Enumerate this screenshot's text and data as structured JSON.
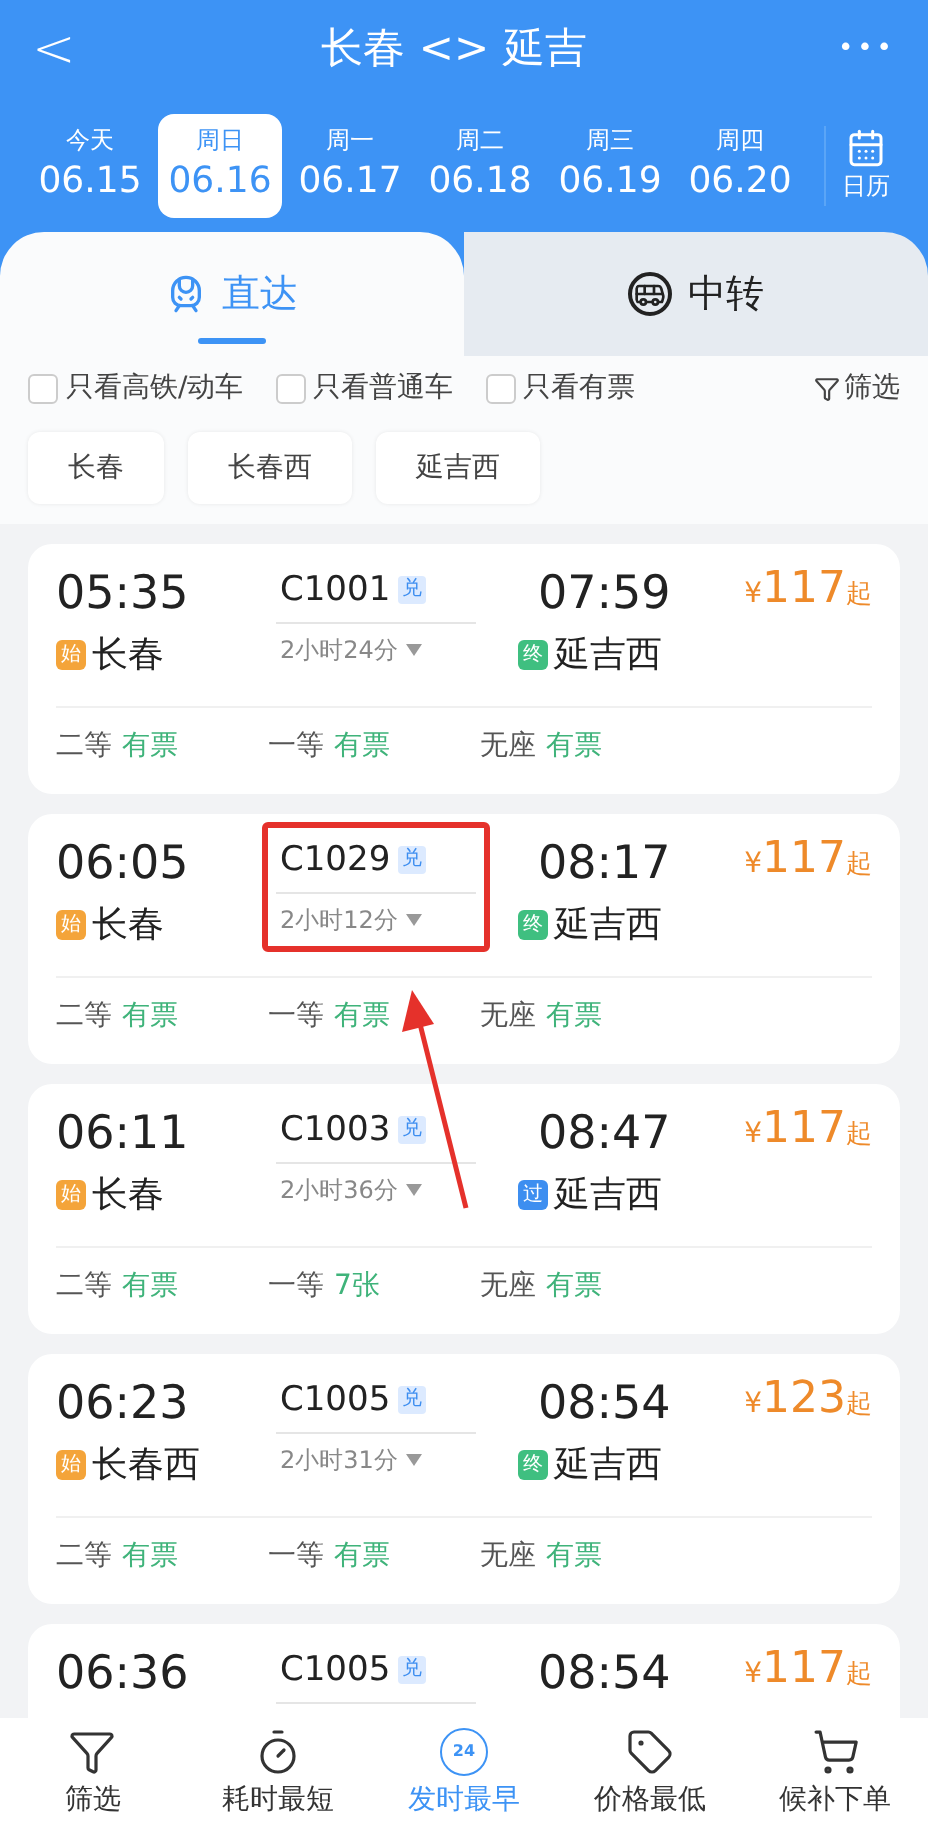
{
  "header": {
    "back": "<",
    "title": "长春 <> 延吉",
    "more": "•••"
  },
  "dates": [
    {
      "weekday": "今天",
      "date": "06.15",
      "selected": false
    },
    {
      "weekday": "周日",
      "date": "06.16",
      "selected": true
    },
    {
      "weekday": "周一",
      "date": "06.17",
      "selected": false
    },
    {
      "weekday": "周二",
      "date": "06.18",
      "selected": false
    },
    {
      "weekday": "周三",
      "date": "06.19",
      "selected": false
    },
    {
      "weekday": "周四",
      "date": "06.20",
      "selected": false
    }
  ],
  "calendar": {
    "label": "日历"
  },
  "tabs": [
    {
      "label": "直达",
      "kind": "direct",
      "selected": true
    },
    {
      "label": "中转",
      "kind": "transfer",
      "selected": false
    }
  ],
  "filters": [
    {
      "label": "只看高铁/动车",
      "checked": false
    },
    {
      "label": "只看普通车",
      "checked": false
    },
    {
      "label": "只看有票",
      "checked": false
    }
  ],
  "filter_button": "筛选",
  "stations": [
    "长春",
    "长春西",
    "延吉西"
  ],
  "trains": [
    {
      "depart": "05:35",
      "from_badge": {
        "kind": "start",
        "label": "始"
      },
      "from": "长春",
      "number": "C1001",
      "tag": "兑",
      "duration": "2小时24分",
      "arrive": "07:59",
      "to_badge": {
        "kind": "end",
        "label": "终"
      },
      "to": "延吉西",
      "price": {
        "currency": "¥",
        "amount": "117",
        "suffix": "起"
      },
      "highlighted": false,
      "seats": [
        {
          "class": "二等",
          "status": "有票"
        },
        {
          "class": "一等",
          "status": "有票"
        },
        {
          "class": "无座",
          "status": "有票"
        }
      ]
    },
    {
      "depart": "06:05",
      "from_badge": {
        "kind": "start",
        "label": "始"
      },
      "from": "长春",
      "number": "C1029",
      "tag": "兑",
      "duration": "2小时12分",
      "arrive": "08:17",
      "to_badge": {
        "kind": "end",
        "label": "终"
      },
      "to": "延吉西",
      "price": {
        "currency": "¥",
        "amount": "117",
        "suffix": "起"
      },
      "highlighted": true,
      "seats": [
        {
          "class": "二等",
          "status": "有票"
        },
        {
          "class": "一等",
          "status": "有票"
        },
        {
          "class": "无座",
          "status": "有票"
        }
      ]
    },
    {
      "depart": "06:11",
      "from_badge": {
        "kind": "start",
        "label": "始"
      },
      "from": "长春",
      "number": "C1003",
      "tag": "兑",
      "duration": "2小时36分",
      "arrive": "08:47",
      "to_badge": {
        "kind": "pass",
        "label": "过"
      },
      "to": "延吉西",
      "price": {
        "currency": "¥",
        "amount": "117",
        "suffix": "起"
      },
      "highlighted": false,
      "seats": [
        {
          "class": "二等",
          "status": "有票"
        },
        {
          "class": "一等",
          "status": "7张"
        },
        {
          "class": "无座",
          "status": "有票"
        }
      ]
    },
    {
      "depart": "06:23",
      "from_badge": {
        "kind": "start",
        "label": "始"
      },
      "from": "长春西",
      "number": "C1005",
      "tag": "兑",
      "duration": "2小时31分",
      "arrive": "08:54",
      "to_badge": {
        "kind": "end",
        "label": "终"
      },
      "to": "延吉西",
      "price": {
        "currency": "¥",
        "amount": "123",
        "suffix": "起"
      },
      "highlighted": false,
      "seats": [
        {
          "class": "二等",
          "status": "有票"
        },
        {
          "class": "一等",
          "status": "有票"
        },
        {
          "class": "无座",
          "status": "有票"
        }
      ]
    },
    {
      "depart": "06:36",
      "number": "C1005",
      "tag": "兑",
      "arrive": "08:54",
      "price": {
        "currency": "¥",
        "amount": "117",
        "suffix": "起"
      },
      "highlighted": false
    }
  ],
  "bottom_nav": [
    {
      "label": "筛选",
      "kind": "filter",
      "selected": false
    },
    {
      "label": "耗时最短",
      "kind": "timer",
      "selected": false
    },
    {
      "label": "发时最早",
      "kind": "clock24",
      "icon_text": "24",
      "selected": true
    },
    {
      "label": "价格最低",
      "kind": "tag",
      "selected": false
    },
    {
      "label": "候补下单",
      "kind": "cart",
      "selected": false
    }
  ]
}
